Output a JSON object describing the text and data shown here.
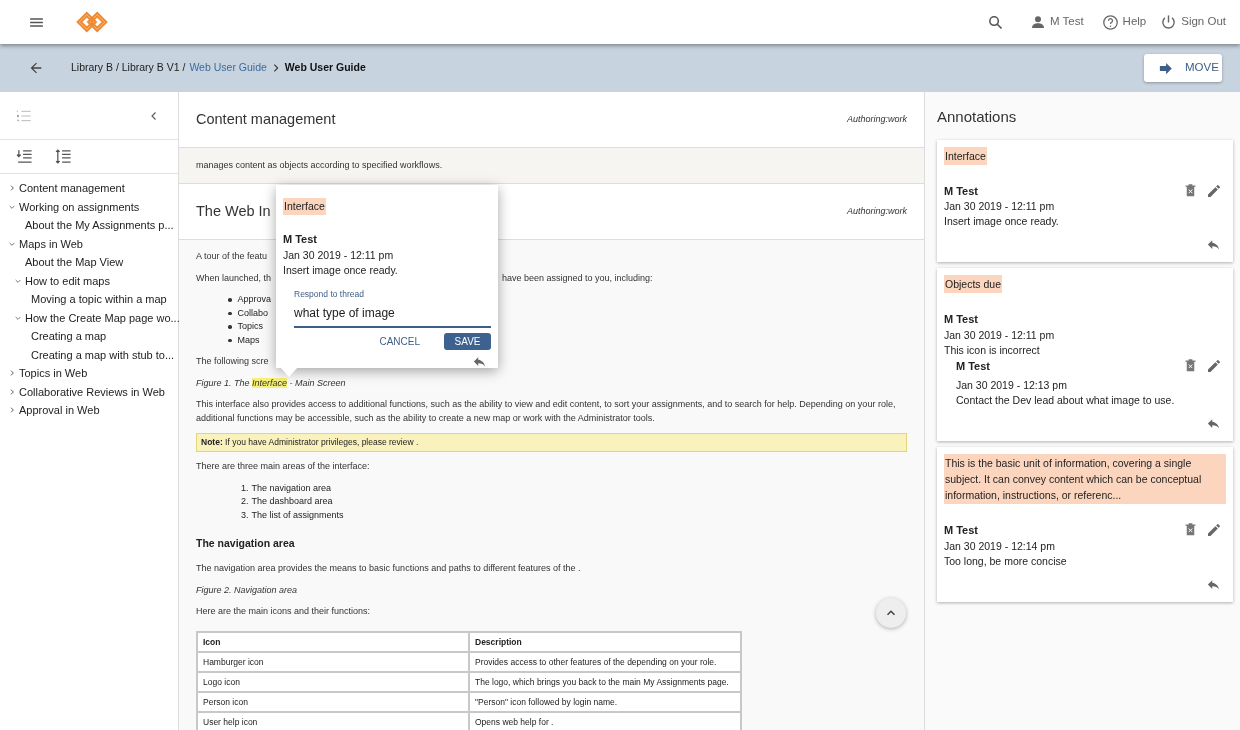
{
  "header": {
    "user": "M Test",
    "help": "Help",
    "sign_out": "Sign Out"
  },
  "breadcrumb": {
    "items": [
      {
        "label": "Library B / Library B V1 /",
        "kind": "text"
      },
      {
        "label": "Web User Guide",
        "kind": "link"
      },
      {
        "label": "Web User Guide",
        "kind": "current"
      }
    ],
    "move_button": "MOVE"
  },
  "toc": {
    "items": [
      {
        "label": "Content management",
        "expanded": false
      },
      {
        "label": "Working on assignments",
        "expanded": true,
        "children": [
          {
            "label": "About the My Assignments p..."
          }
        ]
      },
      {
        "label": "Maps in Web",
        "expanded": true,
        "children": [
          {
            "label": "About the Map View"
          },
          {
            "label": "How to edit maps",
            "expanded": true,
            "children": [
              {
                "label": "Moving a topic within a map"
              }
            ]
          },
          {
            "label": "How the Create Map page wo...",
            "expanded": true,
            "children": [
              {
                "label": "Creating a map"
              },
              {
                "label": "Creating a map with stub to..."
              }
            ]
          }
        ]
      },
      {
        "label": "Topics in Web",
        "expanded": false
      },
      {
        "label": "Collaborative Reviews in Web",
        "expanded": false
      },
      {
        "label": "Approval in Web",
        "expanded": false
      }
    ]
  },
  "sections": [
    {
      "title": "Content management",
      "tag": "Authoring:work",
      "kind": "intro",
      "blocks": [
        {
          "kind": "paragraph",
          "text": "manages content as objects according to specified workflows."
        }
      ]
    },
    {
      "title": "The Web In",
      "tag": "Authoring:work",
      "kind": "main",
      "blocks": [
        {
          "kind": "paragraph",
          "text": "A tour of the featu"
        },
        {
          "kind": "split",
          "left": "When launched, th",
          "right": "have been assigned to you, including:"
        },
        {
          "kind": "bullets",
          "items": [
            "Approva",
            "Collabo",
            "Topics",
            "Maps"
          ]
        },
        {
          "kind": "paragraph",
          "text": "The following scre"
        },
        {
          "kind": "caption",
          "parts": [
            {
              "text": "Figure 1. The ",
              "highlight": false
            },
            {
              "text": "Interface",
              "highlight": true
            },
            {
              "text": " - Main Screen",
              "highlight": false
            }
          ]
        },
        {
          "kind": "paragraph",
          "text": "This interface also provides access to additional functions, such as the ability to view and edit content, to sort your assignments, and to search for help. Depending on your role, additional functions may be accessible, such as the ability to create a new map or work with the Administrator tools."
        },
        {
          "kind": "note",
          "text": "**Note:** If you have Administrator privileges, please review ."
        },
        {
          "kind": "paragraph",
          "text": "There are three main areas of the interface:"
        },
        {
          "kind": "numbered",
          "items": [
            {
              "number": "1.",
              "text": "The navigation area"
            },
            {
              "number": "2.",
              "text": "The dashboard area"
            },
            {
              "number": "3.",
              "text": "The list of assignments"
            }
          ]
        },
        {
          "kind": "heading",
          "text": "The navigation area"
        },
        {
          "kind": "paragraph",
          "text": "The navigation area provides the means to basic functions and paths to different features of the ."
        },
        {
          "kind": "caption",
          "parts": [
            {
              "text": "Figure 2. Navigation area",
              "highlight": false
            }
          ]
        },
        {
          "kind": "paragraph",
          "text": "Here are the main icons and their functions:"
        },
        {
          "kind": "table",
          "columns": [
            "Icon",
            "Description"
          ],
          "rows": [
            [
              "Hamburger icon",
              "Provides access to other features of the depending on your role."
            ],
            [
              "Logo icon",
              "The logo, which brings you back to the main My Assignments page."
            ],
            [
              "Person icon",
              "\"Person\" icon followed by login name."
            ],
            [
              "User help icon",
              "Opens web help for ."
            ]
          ]
        }
      ]
    }
  ],
  "popup": {
    "quote": "Interface",
    "author": "M Test",
    "date": "Jan 30 2019 - 12:11 pm",
    "text": "Insert image once ready.",
    "field_label": "Respond to thread",
    "field_value": "what type of image",
    "cancel": "CANCEL",
    "save": "SAVE"
  },
  "annotations": {
    "title": "Annotations",
    "cards": [
      {
        "quote": "Interface",
        "comments": [
          {
            "author": "M Test",
            "date": "Jan 30 2019 - 12:11 pm",
            "text": "Insert image once ready.",
            "editable": true
          }
        ]
      },
      {
        "quote": "Objects due",
        "comments": [
          {
            "author": "M Test",
            "date": "Jan 30 2019 - 12:11 pm",
            "text": "This icon is incorrect",
            "editable": false,
            "replies": [
              {
                "author": "M Test",
                "date": "Jan 30 2019 - 12:13 pm",
                "text": "Contact the Dev lead about what image to use.",
                "editable": true
              }
            ]
          }
        ]
      },
      {
        "quote": "This is the basic unit of information, covering a single subject. It can convey content which can be conceptual information, instructions, or referenc...",
        "comments": [
          {
            "author": "M Test",
            "date": "Jan 30 2019 - 12:14 pm",
            "text": "Too long, be more concise",
            "editable": true
          }
        ]
      }
    ]
  }
}
